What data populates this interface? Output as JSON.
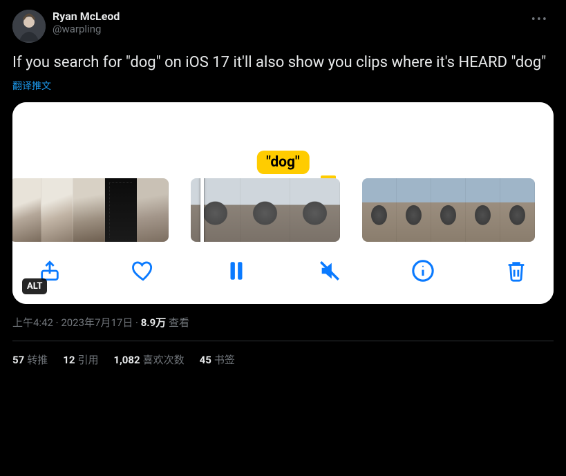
{
  "user": {
    "display_name": "Ryan McLeod",
    "handle": "@warpling"
  },
  "tweet": {
    "text": "If you search for \"dog\" on iOS 17 it'll also show you clips where it's HEARD \"dog\"",
    "translate_label": "翻译推文"
  },
  "media": {
    "tooltip": "\"dog\"",
    "alt_badge": "ALT"
  },
  "meta": {
    "time": "上午4:42",
    "sep1": " · ",
    "date": "2023年7月17日",
    "sep2": " · ",
    "views_count": "8.9万",
    "views_label": " 查看"
  },
  "stats": {
    "retweets_count": "57",
    "retweets_label": "转推",
    "quotes_count": "12",
    "quotes_label": "引用",
    "likes_count": "1,082",
    "likes_label": "喜欢次数",
    "bookmarks_count": "45",
    "bookmarks_label": "书签"
  }
}
